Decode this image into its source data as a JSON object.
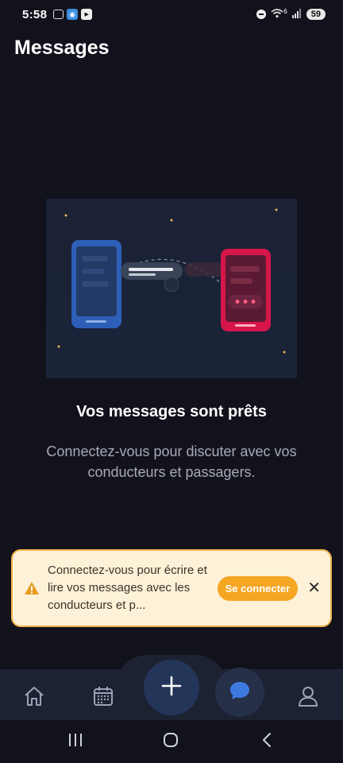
{
  "status_bar": {
    "time": "5:58",
    "network": "6",
    "battery": "59"
  },
  "page": {
    "title": "Messages"
  },
  "empty_state": {
    "heading": "Vos messages sont prêts",
    "subtext": "Connectez-vous pour discuter avec vos conducteurs et passagers."
  },
  "banner": {
    "text": "Connectez-vous pour écrire et lire vos messages avec les conducteurs et p...",
    "button_label": "Se connecter",
    "close_label": "✕"
  },
  "bottom_nav": {
    "items": [
      {
        "icon": "home-icon"
      },
      {
        "icon": "calendar-icon"
      },
      {
        "icon": "plus-icon"
      },
      {
        "icon": "chat-icon",
        "active": true
      },
      {
        "icon": "profile-icon"
      }
    ]
  },
  "colors": {
    "background": "#12121c",
    "accent": "#f5a623",
    "banner_bg": "#fdf1d8",
    "nav_bg": "#1d2233"
  }
}
